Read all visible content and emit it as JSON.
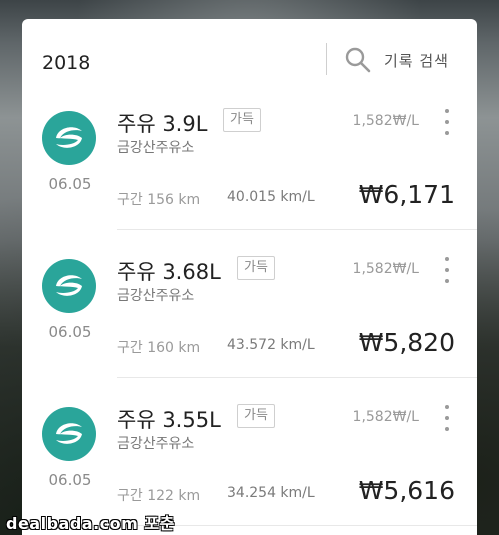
{
  "header": {
    "year": "2018",
    "search_label": "기록 검색"
  },
  "records": [
    {
      "title": "주유 3.9L",
      "badge": "가득",
      "station": "금강산주유소",
      "price_per": "1,582₩/L",
      "date": "06.05",
      "distance": "구간 156 km",
      "efficiency": "40.015 km/L",
      "cost": "₩6,171"
    },
    {
      "title": "주유 3.68L",
      "badge": "가득",
      "station": "금강산주유소",
      "price_per": "1,582₩/L",
      "date": "06.05",
      "distance": "구간 160 km",
      "efficiency": "43.572 km/L",
      "cost": "₩5,820"
    },
    {
      "title": "주유 3.55L",
      "badge": "가득",
      "station": "금강산주유소",
      "price_per": "1,582₩/L",
      "date": "06.05",
      "distance": "구간 122 km",
      "efficiency": "34.254 km/L",
      "cost": "₩5,616"
    }
  ],
  "icons": {
    "search": "search-icon",
    "more": "more-vertical-icon",
    "brand": "gas-station-logo-icon"
  },
  "colors": {
    "brand_teal": "#2aa59a"
  },
  "watermark": "dealbada.com 포춘"
}
